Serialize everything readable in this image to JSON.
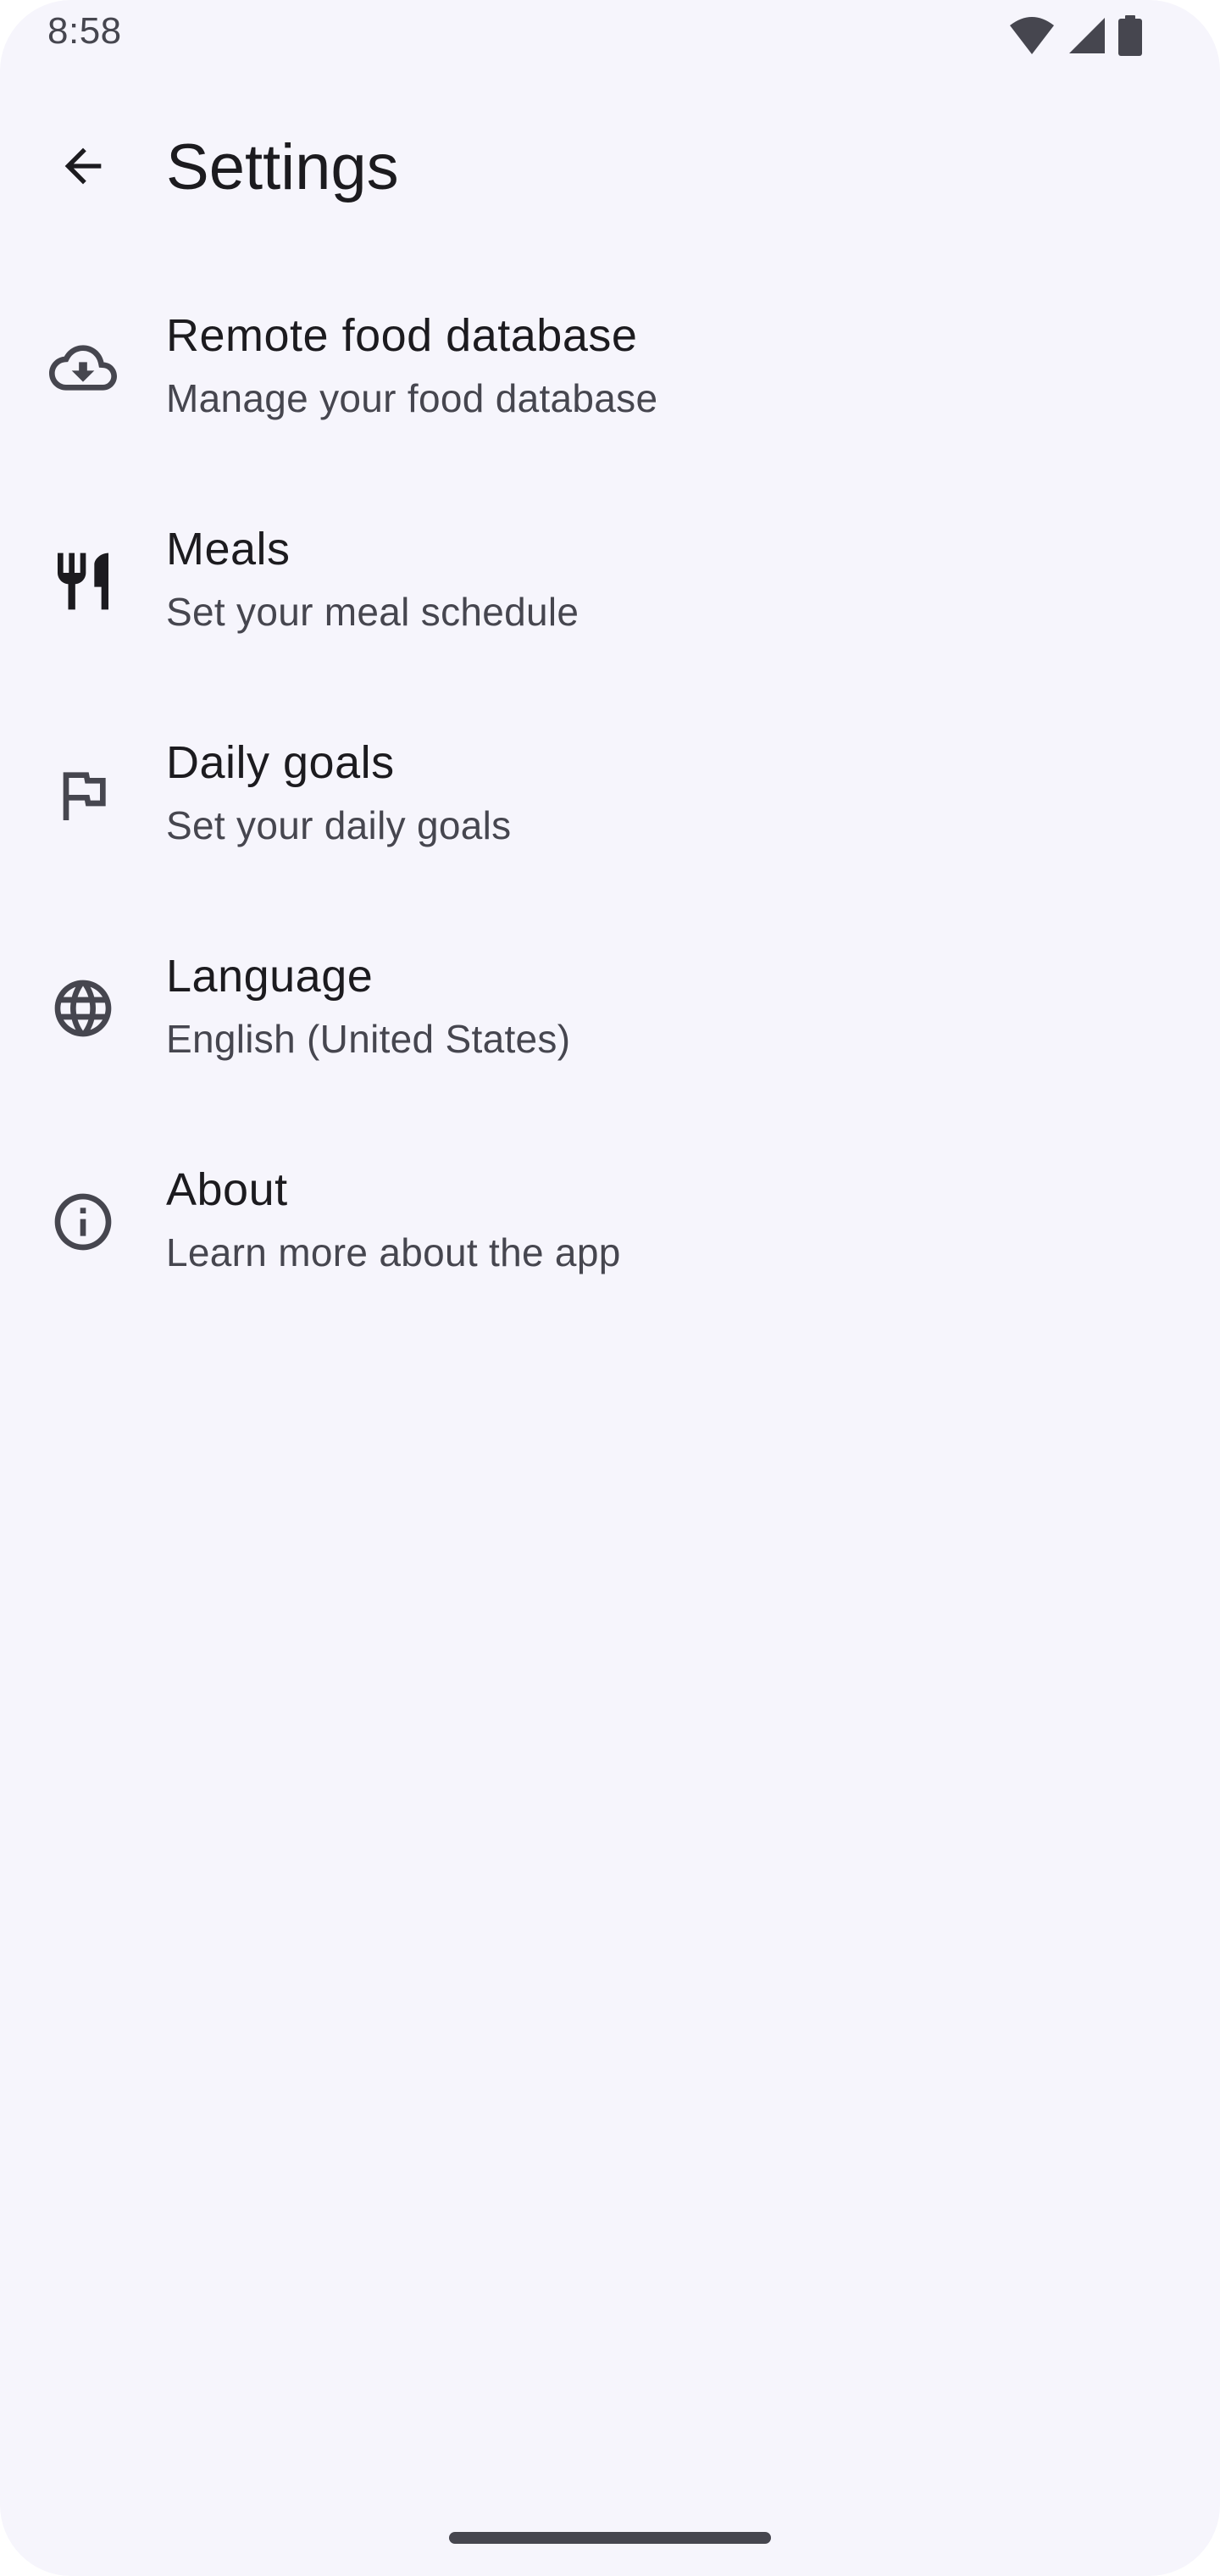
{
  "status_bar": {
    "time": "8:58",
    "icons": [
      "wifi-icon",
      "cellular-signal-icon",
      "battery-icon"
    ]
  },
  "app_bar": {
    "back_icon": "arrow-back-icon",
    "title": "Settings"
  },
  "settings": {
    "items": [
      {
        "icon": "cloud-download-icon",
        "title": "Remote food database",
        "subtitle": "Manage your food database"
      },
      {
        "icon": "restaurant-icon",
        "title": "Meals",
        "subtitle": "Set your meal schedule"
      },
      {
        "icon": "flag-icon",
        "title": "Daily goals",
        "subtitle": "Set your daily goals"
      },
      {
        "icon": "language-globe-icon",
        "title": "Language",
        "subtitle": "English (United States)"
      },
      {
        "icon": "info-icon",
        "title": "About",
        "subtitle": "Learn more about the app"
      }
    ]
  },
  "colors": {
    "background": "#f6f5fc",
    "on_surface": "#1c1b1f",
    "on_surface_variant": "#46464f"
  }
}
